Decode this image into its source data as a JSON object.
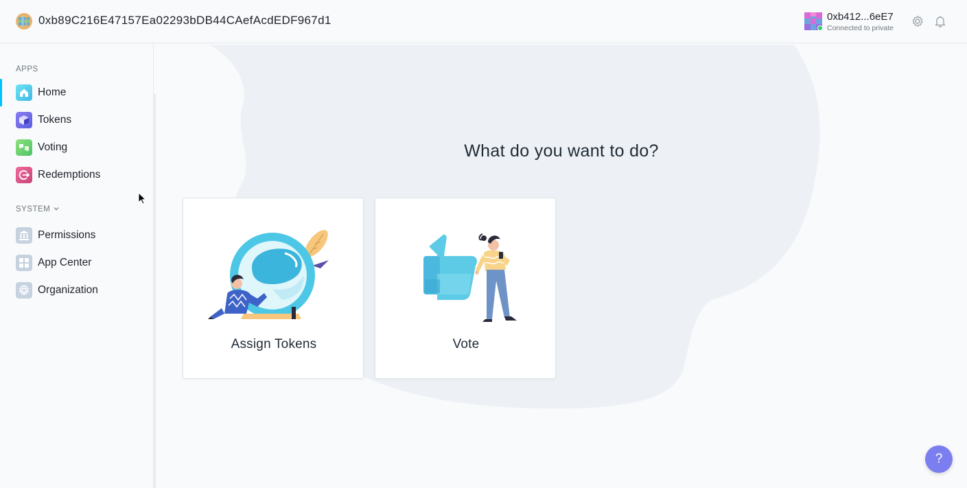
{
  "header": {
    "org_address": "0xb89C216E47157Ea02293bDB44CAefAcdEDF967d1",
    "account_address": "0xb412...6eE7",
    "account_network": "Connected to private"
  },
  "sidebar": {
    "apps_title": "APPS",
    "system_title": "SYSTEM",
    "apps": [
      {
        "label": "Home",
        "icon": "home-icon",
        "active": true
      },
      {
        "label": "Tokens",
        "icon": "tokens-icon"
      },
      {
        "label": "Voting",
        "icon": "voting-icon"
      },
      {
        "label": "Redemptions",
        "icon": "redemptions-icon"
      }
    ],
    "system": [
      {
        "label": "Permissions",
        "icon": "permissions-icon"
      },
      {
        "label": "App Center",
        "icon": "app-center-icon"
      },
      {
        "label": "Organization",
        "icon": "organization-icon"
      }
    ]
  },
  "main": {
    "title": "What do you want to do?",
    "cards": [
      {
        "label": "Assign Tokens",
        "icon": "assign-tokens-illustration"
      },
      {
        "label": "Vote",
        "icon": "vote-illustration"
      }
    ]
  },
  "help": {
    "label": "?"
  },
  "colors": {
    "accent": "#00c2ff",
    "help_button": "#7b7eef",
    "background_blob": "#edf1f5"
  }
}
